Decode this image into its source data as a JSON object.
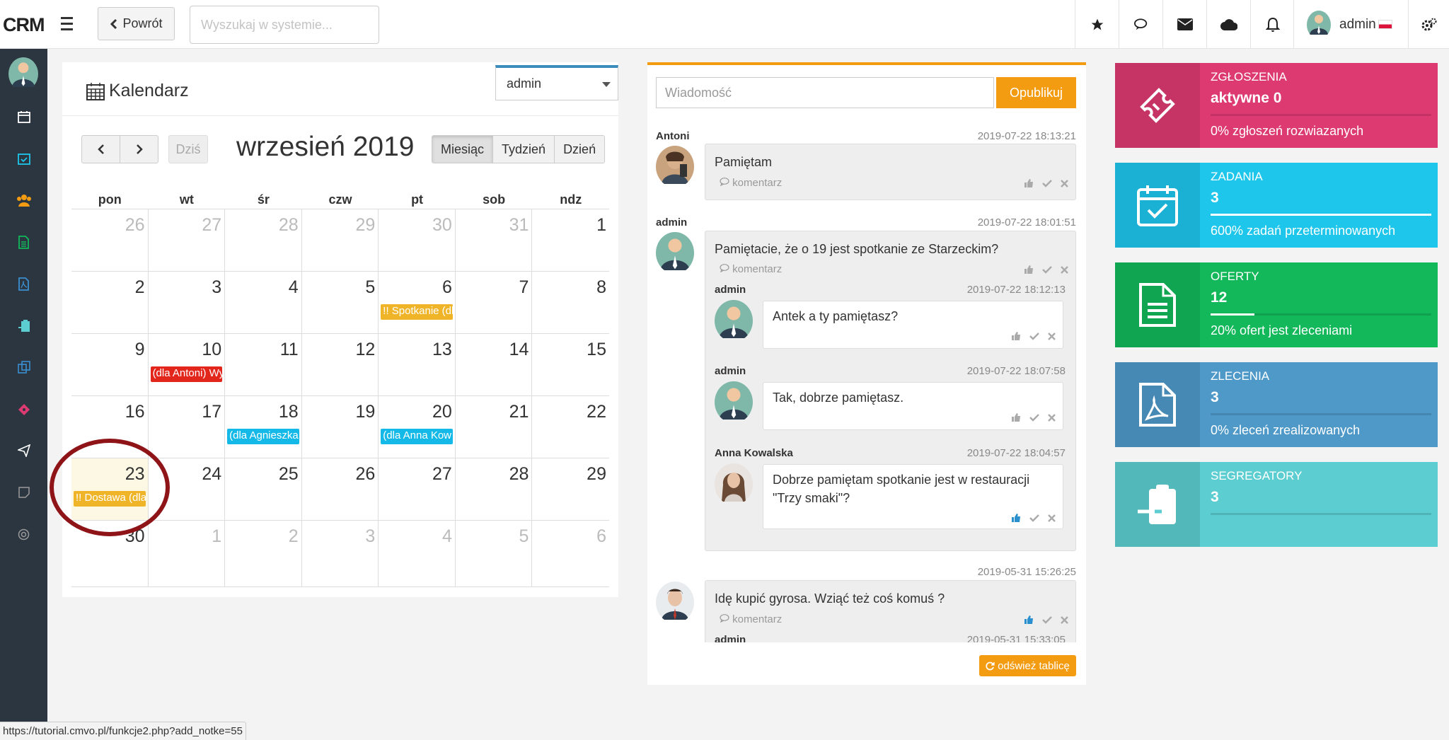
{
  "app": {
    "logo": "CRM"
  },
  "topbar": {
    "back_label": "Powrót",
    "search_placeholder": "Wyszukaj w systemie...",
    "user_name": "admin"
  },
  "calendar": {
    "title": "Kalendarz",
    "user_select": "admin",
    "today_label": "Dziś",
    "month_title": "wrzesień 2019",
    "views": [
      "Miesiąc",
      "Tydzień",
      "Dzień"
    ],
    "weekdays": [
      "pon",
      "wt",
      "śr",
      "czw",
      "pt",
      "sob",
      "ndz"
    ],
    "weeks": [
      [
        {
          "d": "26",
          "o": true
        },
        {
          "d": "27",
          "o": true
        },
        {
          "d": "28",
          "o": true
        },
        {
          "d": "29",
          "o": true
        },
        {
          "d": "30",
          "o": true
        },
        {
          "d": "31",
          "o": true
        },
        {
          "d": "1"
        }
      ],
      [
        {
          "d": "2"
        },
        {
          "d": "3"
        },
        {
          "d": "4"
        },
        {
          "d": "5"
        },
        {
          "d": "6",
          "ev": "!! Spotkanie (dla",
          "c": "#f0b429"
        },
        {
          "d": "7"
        },
        {
          "d": "8"
        }
      ],
      [
        {
          "d": "9"
        },
        {
          "d": "10",
          "ev": "(dla Antoni) Wy",
          "c": "#e2261c"
        },
        {
          "d": "11"
        },
        {
          "d": "12"
        },
        {
          "d": "13"
        },
        {
          "d": "14"
        },
        {
          "d": "15"
        }
      ],
      [
        {
          "d": "16"
        },
        {
          "d": "17"
        },
        {
          "d": "18",
          "ev": "(dla Agnieszka",
          "c": "#14b9e8"
        },
        {
          "d": "19"
        },
        {
          "d": "20",
          "ev": "(dla Anna Kow",
          "c": "#14b9e8"
        },
        {
          "d": "21"
        },
        {
          "d": "22"
        }
      ],
      [
        {
          "d": "23",
          "today": true,
          "ev": "!! Dostawa (dla",
          "c": "#f0b429"
        },
        {
          "d": "24"
        },
        {
          "d": "25"
        },
        {
          "d": "26"
        },
        {
          "d": "27"
        },
        {
          "d": "28"
        },
        {
          "d": "29"
        }
      ],
      [
        {
          "d": "30"
        },
        {
          "d": "1",
          "o": true
        },
        {
          "d": "2",
          "o": true
        },
        {
          "d": "3",
          "o": true
        },
        {
          "d": "4",
          "o": true
        },
        {
          "d": "5",
          "o": true
        },
        {
          "d": "6",
          "o": true
        }
      ]
    ]
  },
  "wall": {
    "message_placeholder": "Wiadomość",
    "publish_label": "Opublikuj",
    "comment_label": "komentarz",
    "refresh_label": "odśwież tablicę",
    "posts": [
      {
        "author": "Antoni",
        "time": "2019-07-22 18:13:21",
        "text": "Pamiętam"
      },
      {
        "author": "admin",
        "time": "2019-07-22 18:01:51",
        "text": "Pamiętacie, że o 19 jest spotkanie ze Starzeckim?"
      },
      {
        "author": "",
        "time": "2019-05-31 15:26:25",
        "text": "Idę kupić gyrosa. Wziąć też coś komuś ?"
      }
    ],
    "replies": [
      {
        "author": "admin",
        "time": "2019-07-22 18:12:13",
        "text": "Antek a ty pamiętasz?"
      },
      {
        "author": "admin",
        "time": "2019-07-22 18:07:58",
        "text": "Tak, dobrze pamiętasz."
      },
      {
        "author": "Anna Kowalska",
        "time": "2019-07-22 18:04:57",
        "text": "Dobrze pamiętam spotkanie jest w restauracji \"Trzy smaki\"?"
      },
      {
        "author": "admin",
        "time": "2019-05-31 15:33:05",
        "text": ""
      }
    ]
  },
  "tiles": [
    {
      "label": "ZGŁOSZENIA",
      "value": "aktywne 0",
      "desc": "0% zgłoszeń rozwiazanych",
      "color": "#dd3a72",
      "icon": "ticket-icon",
      "progress": 0
    },
    {
      "label": "ZADANIA",
      "value": "3",
      "desc": "600% zadań przeterminowanych",
      "color": "#1ec6ec",
      "icon": "calendar-check-icon",
      "progress": 100
    },
    {
      "label": "OFERTY",
      "value": "12",
      "desc": "20% ofert jest zleceniami",
      "color": "#12b85a",
      "icon": "document-icon",
      "progress": 20
    },
    {
      "label": "ZLECENIA",
      "value": "3",
      "desc": "0% zleceń zrealizowanych",
      "color": "#4f99c9",
      "icon": "pdf-icon",
      "progress": 0
    },
    {
      "label": "SEGREGATORY",
      "value": "3",
      "desc": "",
      "color": "#5ccdd0",
      "icon": "clipboard-in-icon",
      "progress": 0
    }
  ],
  "statusbar": {
    "url": "https://tutorial.cmvo.pl/funkcje2.php?add_notke=55"
  }
}
